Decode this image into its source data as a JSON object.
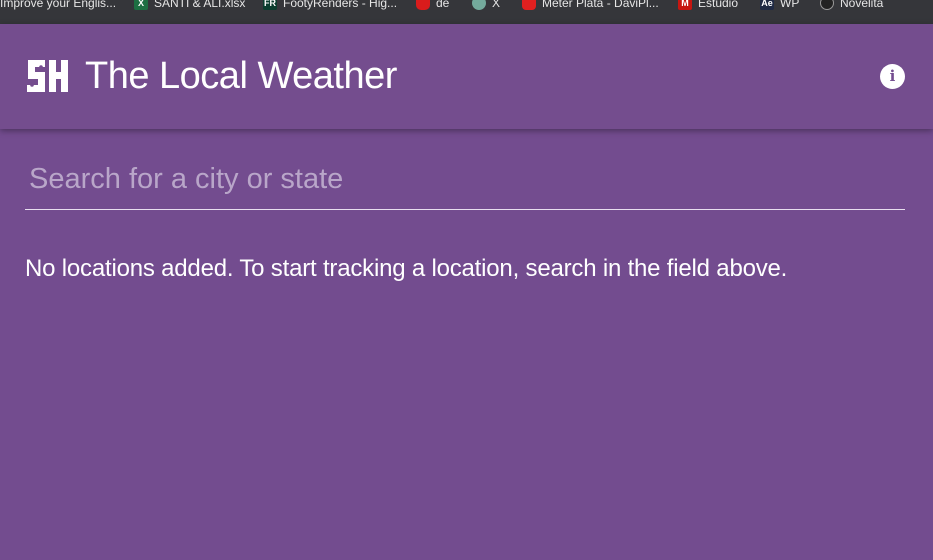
{
  "bookmarks": [
    {
      "label": "Improve your Englis...",
      "icon": "page-icon"
    },
    {
      "label": "SANTI & ALI.xlsx",
      "icon": "excel-icon",
      "color": "#1d6f42"
    },
    {
      "label": "FootyRenders - Hig...",
      "icon": "fr-icon",
      "color": "#0b3d2e"
    },
    {
      "label": "de",
      "icon": "red-bag-icon",
      "color": "#d91c1c"
    },
    {
      "label": "X",
      "icon": "openai-icon",
      "color": "#74aa9c"
    },
    {
      "label": "Meter Plata - DaviPl...",
      "icon": "davi-icon",
      "color": "#e02020"
    },
    {
      "label": "Estudio",
      "icon": "m-icon",
      "color": "#c71610"
    },
    {
      "label": "WP",
      "icon": "ae-icon",
      "color": "#1f2a44"
    },
    {
      "label": "Novelita",
      "icon": "circle-icon",
      "color": "#222222"
    }
  ],
  "header": {
    "title": "The Local Weather",
    "logo_text": "SH",
    "info_symbol": "i"
  },
  "search": {
    "placeholder": "Search for a city or state",
    "value": ""
  },
  "main": {
    "empty_message": "No locations added. To start tracking a location, search in the field above."
  },
  "colors": {
    "background": "#734c8f",
    "appbar": "#744d8e",
    "bookmarks_bar": "#35363a"
  }
}
